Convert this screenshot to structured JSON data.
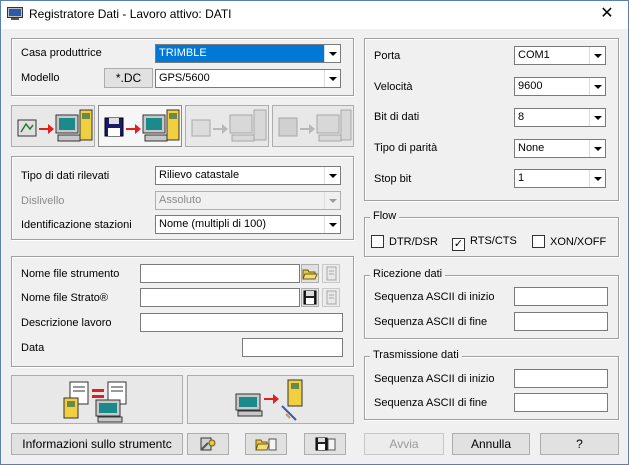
{
  "window": {
    "title": "Registratore Dati - Lavoro attivo: DATI",
    "close_label": "✕"
  },
  "device": {
    "manufacturer_label": "Casa produttrice",
    "manufacturer_value": "TRIMBLE",
    "model_label": "Modello",
    "dc_button_label": "*.DC",
    "model_value": "GPS/5600"
  },
  "survey": {
    "data_type_label": "Tipo di dati rilevati",
    "data_type_value": "Rilievo catastale",
    "height_diff_label": "Dislivello",
    "height_diff_value": "Assoluto",
    "station_id_label": "Identificazione stazioni",
    "station_id_value": "Nome (multipli di 100)"
  },
  "files": {
    "instrument_file_label": "Nome file strumento",
    "instrument_file_value": "",
    "strato_file_label": "Nome file Strato®",
    "strato_file_value": "",
    "job_desc_label": "Descrizione lavoro",
    "job_desc_value": "",
    "date_label": "Data",
    "date_value": ""
  },
  "serial": {
    "port_label": "Porta",
    "port_value": "COM1",
    "speed_label": "Velocità",
    "speed_value": "9600",
    "data_bits_label": "Bit di dati",
    "data_bits_value": "8",
    "parity_label": "Tipo di parità",
    "parity_value": "None",
    "stop_bits_label": "Stop bit",
    "stop_bits_value": "1"
  },
  "flow": {
    "title": "Flow",
    "options": [
      {
        "label": "DTR/DSR",
        "checked": false
      },
      {
        "label": "RTS/CTS",
        "checked": true
      },
      {
        "label": "XON/XOFF",
        "checked": false
      }
    ]
  },
  "receive": {
    "title": "Ricezione dati",
    "start_label": "Sequenza ASCII di inizio",
    "start_value": "",
    "end_label": "Sequenza ASCII di fine",
    "end_value": ""
  },
  "transmit": {
    "title": "Trasmissione dati",
    "start_label": "Sequenza ASCII di inizio",
    "start_value": "",
    "end_label": "Sequenza ASCII di fine",
    "end_value": ""
  },
  "bottom": {
    "info_button": "Informazioni sullo strumentc",
    "send_button": "Avvia",
    "cancel_button": "Annulla",
    "help_button": "?"
  },
  "colors": {
    "selection": "#0078d7",
    "panel_bg": "#f0f0f0"
  }
}
